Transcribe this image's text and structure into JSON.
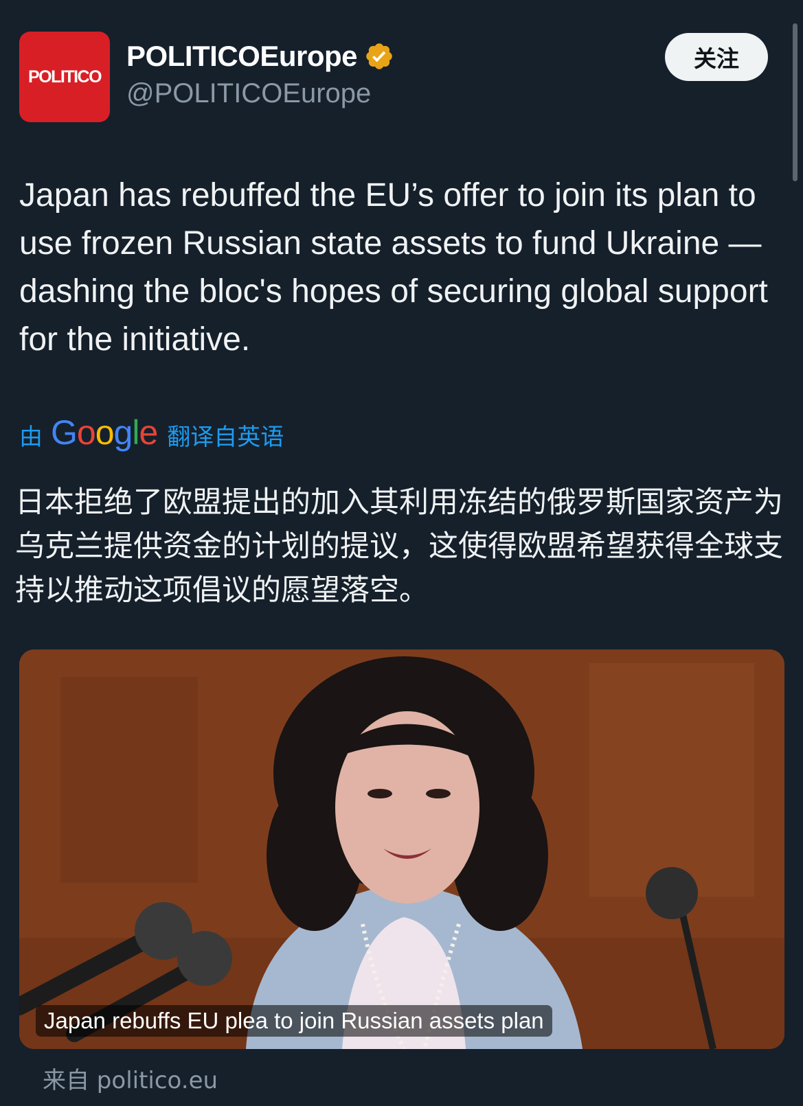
{
  "account": {
    "avatar_text": "POLITICO",
    "display_name": "POLITICOEurope",
    "handle": "@POLITICOEurope",
    "verified": true,
    "verified_color": "#e8a317"
  },
  "follow_button": {
    "label": "关注"
  },
  "tweet": {
    "text": "Japan has rebuffed the EU’s offer to join its plan to use frozen Russian state assets to fund Ukraine — dashing the bloc's hopes of securing global support for the initiative."
  },
  "translation": {
    "prefix": "由",
    "provider_letters": [
      "G",
      "o",
      "o",
      "g",
      "l",
      "e"
    ],
    "suffix": "翻译自英语",
    "text": "日本拒绝了欧盟提出的加入其利用冻结的俄罗斯国家资产为乌克兰提供资金的计划的提议，这使得欧盟希望获得全球支持以推动这项倡议的愿望落空。"
  },
  "link_card": {
    "caption": "Japan rebuffs EU plea to join Russian assets plan",
    "image_description_icon": "photo-of-speaker-at-podium"
  },
  "source": {
    "label": "来自 politico.eu"
  },
  "colors": {
    "background": "#15202b",
    "link_blue": "#1d9bf0",
    "muted_text": "#8b98a5",
    "avatar_red": "#d91f26"
  }
}
